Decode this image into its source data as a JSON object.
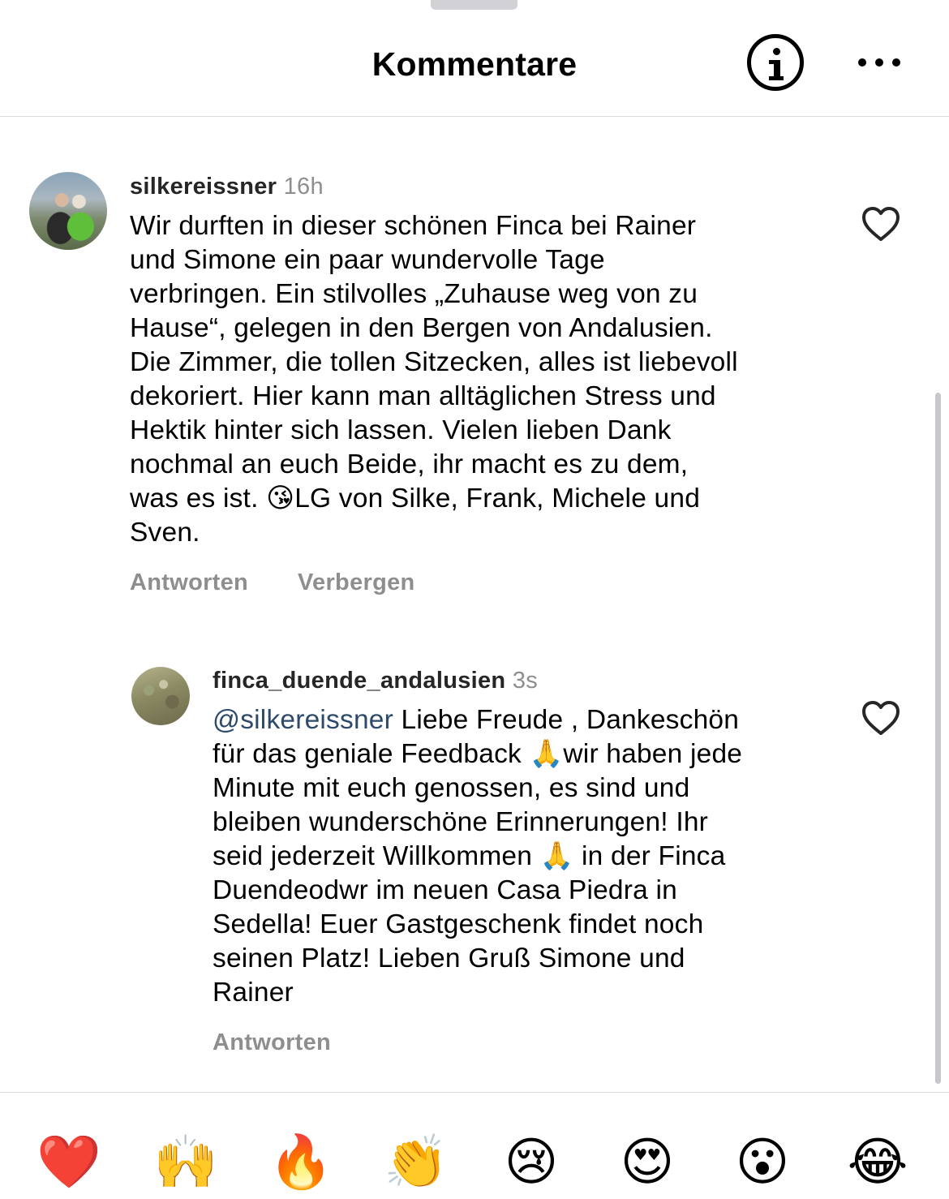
{
  "header": {
    "title": "Kommentare",
    "info_icon": "info-circle-icon",
    "more_icon": "more-horizontal-icon"
  },
  "comments": [
    {
      "username": "silkereissner",
      "time": "16h",
      "text": "Wir durften in dieser schönen Finca bei Rainer\nund Simone ein paar wundervolle Tage\nverbringen. Ein stilvolles „Zuhause weg von zu\nHause“, gelegen in den Bergen von Andalusien.\nDie Zimmer, die tollen Sitzecken, alles ist liebevoll\ndekoriert. Hier kann man alltäglichen Stress und\nHektik hinter sich lassen. Vielen lieben Dank\nnochmal an euch Beide, ihr macht es zu dem,\nwas es ist. 😘LG von Silke, Frank, Michele und\nSven.",
      "reply_label": "Antworten",
      "hide_label": "Verbergen"
    },
    {
      "username": "finca_duende_andalusien",
      "time": "3s",
      "mention": "@silkereissner",
      "text": " Liebe Freude , Dankeschön\nfür das geniale Feedback 🙏wir haben jede\nMinute mit euch genossen, es sind und\nbleiben wunderschöne Erinnerungen! Ihr\nseid jederzeit Willkommen 🙏 in der Finca\nDuendeodwr im neuen Casa Piedra in\nSedella! Euer Gastgeschenk findet noch\nseinen Platz! Lieben Gruß Simone und\nRainer",
      "reply_label": "Antworten"
    }
  ],
  "reactions": [
    "❤️",
    "🙌",
    "🔥",
    "👏",
    "😢",
    "😍",
    "😮",
    "😂"
  ],
  "colors": {
    "username": "#262626",
    "muted": "#8e8e8e",
    "mention": "#2e4a6b",
    "divider": "#dbdbdb"
  }
}
